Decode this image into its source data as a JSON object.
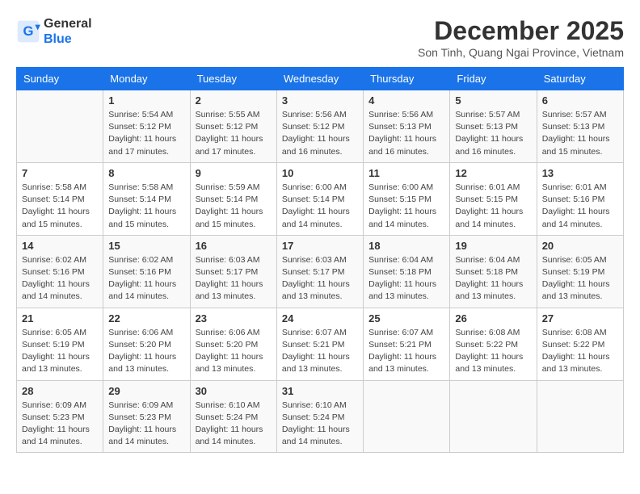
{
  "header": {
    "logo_general": "General",
    "logo_blue": "Blue",
    "month_title": "December 2025",
    "location": "Son Tinh, Quang Ngai Province, Vietnam"
  },
  "weekdays": [
    "Sunday",
    "Monday",
    "Tuesday",
    "Wednesday",
    "Thursday",
    "Friday",
    "Saturday"
  ],
  "weeks": [
    [
      {
        "day": "",
        "info": ""
      },
      {
        "day": "1",
        "info": "Sunrise: 5:54 AM\nSunset: 5:12 PM\nDaylight: 11 hours\nand 17 minutes."
      },
      {
        "day": "2",
        "info": "Sunrise: 5:55 AM\nSunset: 5:12 PM\nDaylight: 11 hours\nand 17 minutes."
      },
      {
        "day": "3",
        "info": "Sunrise: 5:56 AM\nSunset: 5:12 PM\nDaylight: 11 hours\nand 16 minutes."
      },
      {
        "day": "4",
        "info": "Sunrise: 5:56 AM\nSunset: 5:13 PM\nDaylight: 11 hours\nand 16 minutes."
      },
      {
        "day": "5",
        "info": "Sunrise: 5:57 AM\nSunset: 5:13 PM\nDaylight: 11 hours\nand 16 minutes."
      },
      {
        "day": "6",
        "info": "Sunrise: 5:57 AM\nSunset: 5:13 PM\nDaylight: 11 hours\nand 15 minutes."
      }
    ],
    [
      {
        "day": "7",
        "info": "Sunrise: 5:58 AM\nSunset: 5:14 PM\nDaylight: 11 hours\nand 15 minutes."
      },
      {
        "day": "8",
        "info": "Sunrise: 5:58 AM\nSunset: 5:14 PM\nDaylight: 11 hours\nand 15 minutes."
      },
      {
        "day": "9",
        "info": "Sunrise: 5:59 AM\nSunset: 5:14 PM\nDaylight: 11 hours\nand 15 minutes."
      },
      {
        "day": "10",
        "info": "Sunrise: 6:00 AM\nSunset: 5:14 PM\nDaylight: 11 hours\nand 14 minutes."
      },
      {
        "day": "11",
        "info": "Sunrise: 6:00 AM\nSunset: 5:15 PM\nDaylight: 11 hours\nand 14 minutes."
      },
      {
        "day": "12",
        "info": "Sunrise: 6:01 AM\nSunset: 5:15 PM\nDaylight: 11 hours\nand 14 minutes."
      },
      {
        "day": "13",
        "info": "Sunrise: 6:01 AM\nSunset: 5:16 PM\nDaylight: 11 hours\nand 14 minutes."
      }
    ],
    [
      {
        "day": "14",
        "info": "Sunrise: 6:02 AM\nSunset: 5:16 PM\nDaylight: 11 hours\nand 14 minutes."
      },
      {
        "day": "15",
        "info": "Sunrise: 6:02 AM\nSunset: 5:16 PM\nDaylight: 11 hours\nand 14 minutes."
      },
      {
        "day": "16",
        "info": "Sunrise: 6:03 AM\nSunset: 5:17 PM\nDaylight: 11 hours\nand 13 minutes."
      },
      {
        "day": "17",
        "info": "Sunrise: 6:03 AM\nSunset: 5:17 PM\nDaylight: 11 hours\nand 13 minutes."
      },
      {
        "day": "18",
        "info": "Sunrise: 6:04 AM\nSunset: 5:18 PM\nDaylight: 11 hours\nand 13 minutes."
      },
      {
        "day": "19",
        "info": "Sunrise: 6:04 AM\nSunset: 5:18 PM\nDaylight: 11 hours\nand 13 minutes."
      },
      {
        "day": "20",
        "info": "Sunrise: 6:05 AM\nSunset: 5:19 PM\nDaylight: 11 hours\nand 13 minutes."
      }
    ],
    [
      {
        "day": "21",
        "info": "Sunrise: 6:05 AM\nSunset: 5:19 PM\nDaylight: 11 hours\nand 13 minutes."
      },
      {
        "day": "22",
        "info": "Sunrise: 6:06 AM\nSunset: 5:20 PM\nDaylight: 11 hours\nand 13 minutes."
      },
      {
        "day": "23",
        "info": "Sunrise: 6:06 AM\nSunset: 5:20 PM\nDaylight: 11 hours\nand 13 minutes."
      },
      {
        "day": "24",
        "info": "Sunrise: 6:07 AM\nSunset: 5:21 PM\nDaylight: 11 hours\nand 13 minutes."
      },
      {
        "day": "25",
        "info": "Sunrise: 6:07 AM\nSunset: 5:21 PM\nDaylight: 11 hours\nand 13 minutes."
      },
      {
        "day": "26",
        "info": "Sunrise: 6:08 AM\nSunset: 5:22 PM\nDaylight: 11 hours\nand 13 minutes."
      },
      {
        "day": "27",
        "info": "Sunrise: 6:08 AM\nSunset: 5:22 PM\nDaylight: 11 hours\nand 13 minutes."
      }
    ],
    [
      {
        "day": "28",
        "info": "Sunrise: 6:09 AM\nSunset: 5:23 PM\nDaylight: 11 hours\nand 14 minutes."
      },
      {
        "day": "29",
        "info": "Sunrise: 6:09 AM\nSunset: 5:23 PM\nDaylight: 11 hours\nand 14 minutes."
      },
      {
        "day": "30",
        "info": "Sunrise: 6:10 AM\nSunset: 5:24 PM\nDaylight: 11 hours\nand 14 minutes."
      },
      {
        "day": "31",
        "info": "Sunrise: 6:10 AM\nSunset: 5:24 PM\nDaylight: 11 hours\nand 14 minutes."
      },
      {
        "day": "",
        "info": ""
      },
      {
        "day": "",
        "info": ""
      },
      {
        "day": "",
        "info": ""
      }
    ]
  ]
}
